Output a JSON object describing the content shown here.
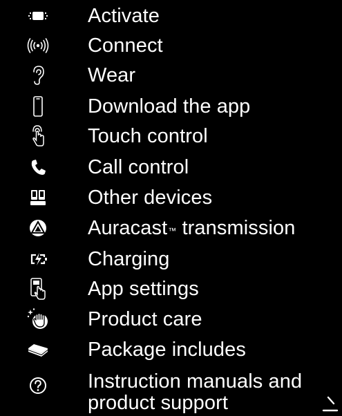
{
  "menu": {
    "items": [
      {
        "label": "Activate",
        "icon": "battery-activate-icon"
      },
      {
        "label": "Connect",
        "icon": "wireless-signal-icon"
      },
      {
        "label": "Wear",
        "icon": "ear-icon"
      },
      {
        "label": "Download the app",
        "icon": "smartphone-icon"
      },
      {
        "label": "Touch control",
        "icon": "touch-finger-icon"
      },
      {
        "label": "Call control",
        "icon": "phone-call-icon"
      },
      {
        "label": "Other devices",
        "icon": "devices-icon"
      },
      {
        "label": "Auracast",
        "label_tm": "™",
        "label_suffix": " transmission",
        "icon": "auracast-icon"
      },
      {
        "label": "Charging",
        "icon": "charging-icon"
      },
      {
        "label": "App settings",
        "icon": "app-settings-icon"
      },
      {
        "label": "Product care",
        "icon": "product-care-icon"
      },
      {
        "label": "Package includes",
        "icon": "package-icon"
      },
      {
        "label_line1": "Instruction manuals and",
        "label_line2": "product support",
        "icon": "help-icon"
      }
    ]
  },
  "colors": {
    "background": "#000000",
    "text": "#ffffff"
  }
}
